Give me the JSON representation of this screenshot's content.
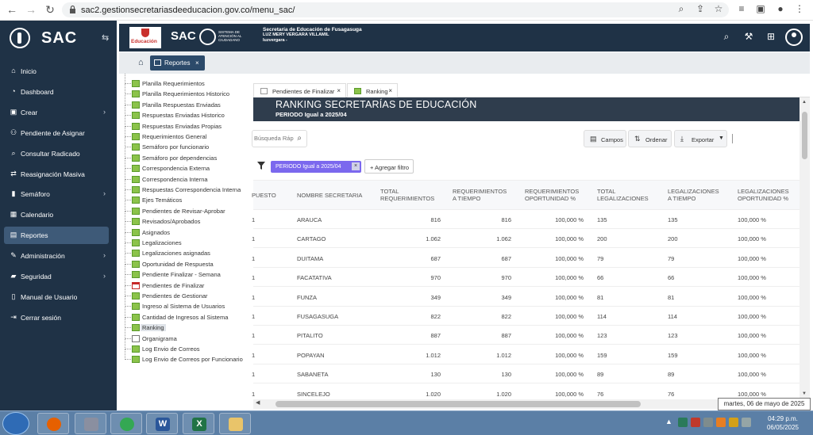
{
  "browser": {
    "url": "sac2.gestionsecretariasdeeducacion.gov.co/menu_sac/"
  },
  "sidebar": {
    "brand": "SAC",
    "items": [
      {
        "label": "Inicio",
        "icon": "home-icon",
        "chevron": false
      },
      {
        "label": "Dashboard",
        "icon": "dashboard-icon",
        "chevron": false
      },
      {
        "label": "Crear",
        "icon": "create-icon",
        "chevron": true
      },
      {
        "label": "Pendiente de Asignar",
        "icon": "user-assign-icon",
        "chevron": false
      },
      {
        "label": "Consultar Radicado",
        "icon": "search-icon",
        "chevron": false
      },
      {
        "label": "Reasignación Masiva",
        "icon": "reassign-icon",
        "chevron": false
      },
      {
        "label": "Semáforo",
        "icon": "traffic-light-icon",
        "chevron": true
      },
      {
        "label": "Calendario",
        "icon": "calendar-icon",
        "chevron": false
      },
      {
        "label": "Reportes",
        "icon": "table-icon",
        "chevron": false,
        "active": true
      },
      {
        "label": "Administración",
        "icon": "wrench-icon",
        "chevron": true
      },
      {
        "label": "Seguridad",
        "icon": "lock-icon",
        "chevron": true
      },
      {
        "label": "Manual de Usuario",
        "icon": "book-icon",
        "chevron": false
      },
      {
        "label": "Cerrar sesión",
        "icon": "logout-icon",
        "chevron": false
      }
    ]
  },
  "header": {
    "edu_logo_text": "Educación",
    "sac_logo": "SAC",
    "sac_subtitle": "SISTEMA DE ATENCIÓN AL CIUDADANO",
    "secretaria": "Secretaría de Educación de Fusagasuga",
    "user_name": "LUZ MERY VERGARA VILLAMIL",
    "user_login": "luzvergara -"
  },
  "breadcrumb": {
    "tab_label": "Reportes",
    "tab_close": "×"
  },
  "tree": {
    "items": [
      {
        "label": "Planilla Requerimientos",
        "icon": "grid"
      },
      {
        "label": "Planilla Requerimientos Historico",
        "icon": "grid"
      },
      {
        "label": "Planilla Respuestas Enviadas",
        "icon": "grid"
      },
      {
        "label": "Respuestas Enviadas Historico",
        "icon": "grid"
      },
      {
        "label": "Respuestas Enviadas Propias",
        "icon": "grid"
      },
      {
        "label": "Requerimientos General",
        "icon": "grid"
      },
      {
        "label": "Semáforo por funcionario",
        "icon": "grid"
      },
      {
        "label": "Semáforo por dependencias",
        "icon": "grid"
      },
      {
        "label": "Correspondencia Externa",
        "icon": "grid"
      },
      {
        "label": "Correspondencia Interna",
        "icon": "grid"
      },
      {
        "label": "Respuestas Correspondencia Interna",
        "icon": "grid"
      },
      {
        "label": "Ejes Temáticos",
        "icon": "grid"
      },
      {
        "label": "Pendientes de Revisar-Aprobar",
        "icon": "grid"
      },
      {
        "label": "Revisados/Aprobados",
        "icon": "grid"
      },
      {
        "label": "Asignados",
        "icon": "grid"
      },
      {
        "label": "Legalizaciones",
        "icon": "grid"
      },
      {
        "label": "Legalizaciones asignadas",
        "icon": "grid"
      },
      {
        "label": "Oportunidad de Respuesta",
        "icon": "grid"
      },
      {
        "label": "Pendiente Finalizar - Semana",
        "icon": "grid"
      },
      {
        "label": "Pendientes de Finalizar",
        "icon": "cal"
      },
      {
        "label": "Pendientes de Gestionar",
        "icon": "grid"
      },
      {
        "label": "Ingreso al Sistema de Usuarios",
        "icon": "grid"
      },
      {
        "label": "Cantidad de Ingresos al Sistema",
        "icon": "grid"
      },
      {
        "label": "Ranking",
        "icon": "grid",
        "selected": true
      },
      {
        "label": "Organigrama",
        "icon": "doc"
      },
      {
        "label": "Log Envio de Correos",
        "icon": "grid"
      },
      {
        "label": "Log Envio de Correos por Funcionario",
        "icon": "grid"
      }
    ]
  },
  "content_tabs": [
    {
      "label": "Pendientes de Finalizar",
      "close": "×"
    },
    {
      "label": "Ranking",
      "close": "×"
    }
  ],
  "report": {
    "title": "RANKING SECRETARÍAS DE EDUCACIÓN",
    "subtitle": "PERIODO Igual a 2025/04",
    "search_placeholder": "Búsqueda Rápida",
    "buttons": {
      "campos": "Campos",
      "ordenar": "Ordenar",
      "exportar": "Exportar"
    },
    "filter_chip": "PERIODO Igual a 2025/04",
    "filter_chip_close": "×",
    "add_filter": "+ Agregar filtro"
  },
  "table": {
    "headers": [
      [
        "PUESTO"
      ],
      [
        "NOMBRE SECRETARIA"
      ],
      [
        "TOTAL",
        "REQUERIMIENTOS"
      ],
      [
        "REQUERIMIENTOS",
        "A TIEMPO"
      ],
      [
        "REQUERIMIENTOS",
        "OPORTUNIDAD %"
      ],
      [
        "TOTAL",
        "LEGALIZACIONES"
      ],
      [
        "LEGALIZACIONES",
        "A TIEMPO"
      ],
      [
        "LEGALIZACIONES",
        "OPORTUNIDAD %"
      ]
    ],
    "rows": [
      [
        "1",
        "ARAUCA",
        "816",
        "816",
        "100,000 %",
        "135",
        "135",
        "100,000 %"
      ],
      [
        "1",
        "CARTAGO",
        "1.062",
        "1.062",
        "100,000 %",
        "200",
        "200",
        "100,000 %"
      ],
      [
        "1",
        "DUITAMA",
        "687",
        "687",
        "100,000 %",
        "79",
        "79",
        "100,000 %"
      ],
      [
        "1",
        "FACATATIVA",
        "970",
        "970",
        "100,000 %",
        "66",
        "66",
        "100,000 %"
      ],
      [
        "1",
        "FUNZA",
        "349",
        "349",
        "100,000 %",
        "81",
        "81",
        "100,000 %"
      ],
      [
        "1",
        "FUSAGASUGA",
        "822",
        "822",
        "100,000 %",
        "114",
        "114",
        "100,000 %"
      ],
      [
        "1",
        "PITALITO",
        "887",
        "887",
        "100,000 %",
        "123",
        "123",
        "100,000 %"
      ],
      [
        "1",
        "POPAYAN",
        "1.012",
        "1.012",
        "100,000 %",
        "159",
        "159",
        "100,000 %"
      ],
      [
        "1",
        "SABANETA",
        "130",
        "130",
        "100,000 %",
        "89",
        "89",
        "100,000 %"
      ],
      [
        "1",
        "SINCELEJO",
        "1.020",
        "1.020",
        "100,000 %",
        "76",
        "76",
        "100,000 %"
      ]
    ]
  },
  "tooltip_date": "martes, 06 de mayo de 2025",
  "taskbar": {
    "time": "04:29 p.m.",
    "date": "06/05/2025",
    "apps": [
      {
        "name": "firefox-icon",
        "glyph": "",
        "color": "#e66000"
      },
      {
        "name": "tools-icon",
        "glyph": "",
        "color": "#8a8fa0"
      },
      {
        "name": "chrome-icon",
        "glyph": "",
        "color": "#34a853"
      },
      {
        "name": "word-icon",
        "glyph": "W",
        "color": "#2b579a"
      },
      {
        "name": "excel-icon",
        "glyph": "X",
        "color": "#217346"
      },
      {
        "name": "folder-icon",
        "glyph": "",
        "color": "#e9c46a"
      }
    ]
  }
}
